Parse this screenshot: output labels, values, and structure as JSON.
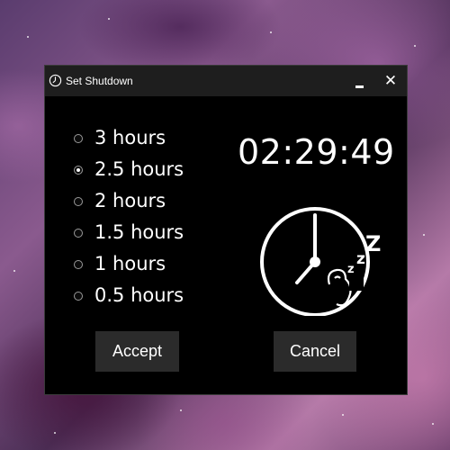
{
  "window": {
    "title": "Set Shutdown",
    "minimize_icon": "minimize-icon",
    "close_label": "X"
  },
  "options": [
    {
      "label": "3 hours",
      "selected": false
    },
    {
      "label": "2.5 hours",
      "selected": true
    },
    {
      "label": "2 hours",
      "selected": false
    },
    {
      "label": "1.5 hours",
      "selected": false
    },
    {
      "label": "1 hours",
      "selected": false
    },
    {
      "label": "0.5 hours",
      "selected": false
    }
  ],
  "countdown": "02:29:49",
  "clock_icon": {
    "sleep_text": "zzZ"
  },
  "buttons": {
    "accept_label": "Accept",
    "cancel_label": "Cancel"
  },
  "colors": {
    "window_bg": "#000000",
    "titlebar_bg": "#1e1e1e",
    "button_bg": "#2b2b2b",
    "text": "#ffffff"
  }
}
